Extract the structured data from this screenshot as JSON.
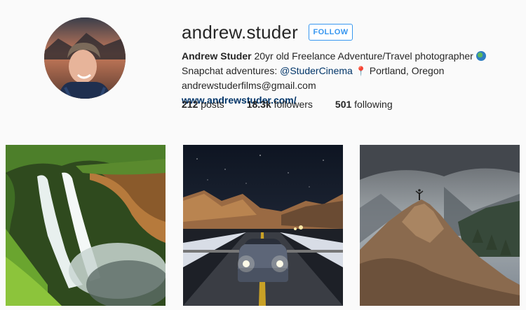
{
  "profile": {
    "username": "andrew.studer",
    "follow_label": "FOLLOW",
    "full_name": "Andrew Studer",
    "bio_text_1": " 20yr old Freelance Adventure/Travel photographer ",
    "bio_text_2": " Snapchat adventures: ",
    "snapchat_handle": "@StuderCinema",
    "bio_text_3": " Portland, Oregon andrewstuderfilms@gmail.com",
    "website": "www.andrewstuder.com/"
  },
  "stats": {
    "posts_count": "212",
    "posts_label": " posts",
    "followers_count": "18.3k",
    "followers_label": " followers",
    "following_count": "501",
    "following_label": " following"
  },
  "icons": {
    "globe": "globe-emoji-icon",
    "pin": "round-pushpin-icon"
  },
  "colors": {
    "accent": "#3897f0",
    "link": "#003569",
    "text": "#262626",
    "background": "#fafafa"
  }
}
